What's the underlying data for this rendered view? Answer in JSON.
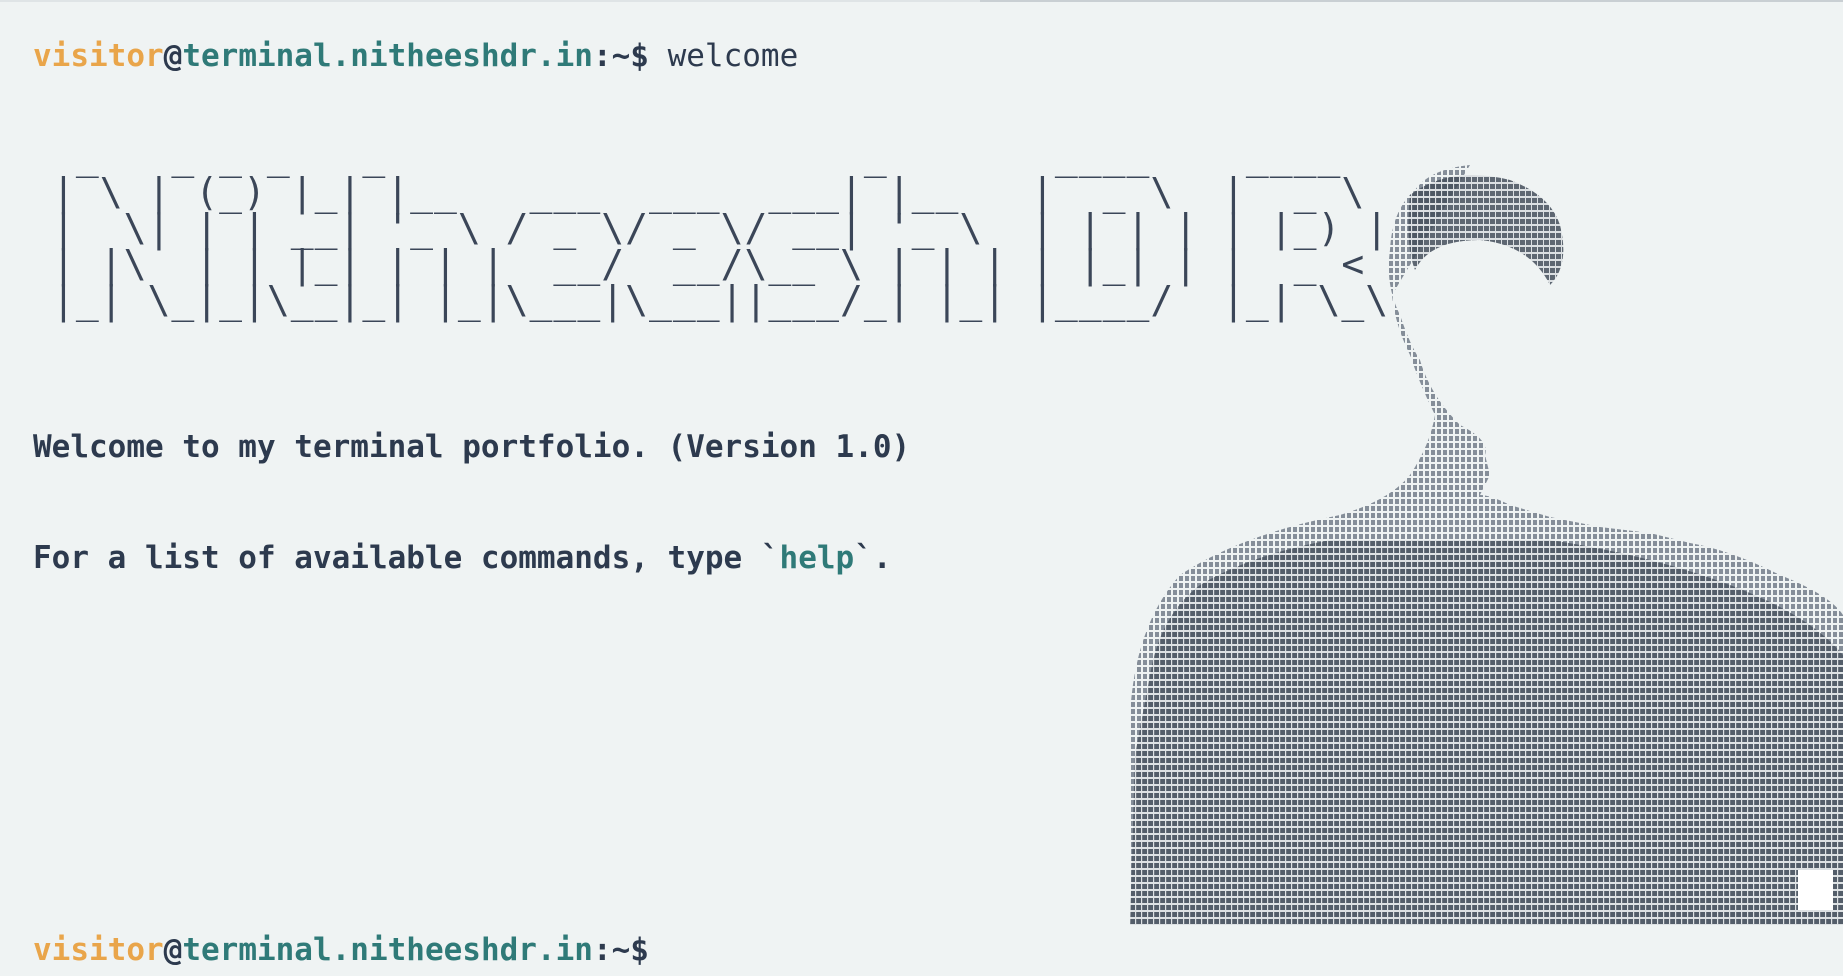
{
  "prompt": {
    "user": "visitor",
    "at": "@",
    "host": "terminal.nitheeshdr.in",
    "path": ":~$",
    "command": "welcome"
  },
  "banner": {
    "lines": [
      " _   _ _ _   _                    _       ____    ____  ",
      "| \\ | (_) |_| |__   ___  ___  ___| |__   |  _ \\  |  _ \\ ",
      "|  \\| | | __| '_ \\ / _ \\/ _ \\/ __| '_ \\  | | | | | |_) |",
      "| |\\  | | |_| | | |  __/  __/\\__ \\ | | | | |_| | |  _ < ",
      "|_| \\_|_|\\__|_| |_|\\___|\\___||___/_| |_| |____/  |_| \\_\\"
    ]
  },
  "welcome": {
    "line1": "Welcome to my terminal portfolio. (Version 1.0)",
    "line2_prefix": "For a list of available commands, type `",
    "line2_command": "help",
    "line2_suffix": "`."
  },
  "prompt2": {
    "user": "visitor",
    "at": "@",
    "host": "terminal.nitheeshdr.in",
    "path": ":~$"
  },
  "colors": {
    "background": "#eff3f3",
    "user": "#e9a54a",
    "host": "#2f7a78",
    "text": "#2d3a4e"
  }
}
